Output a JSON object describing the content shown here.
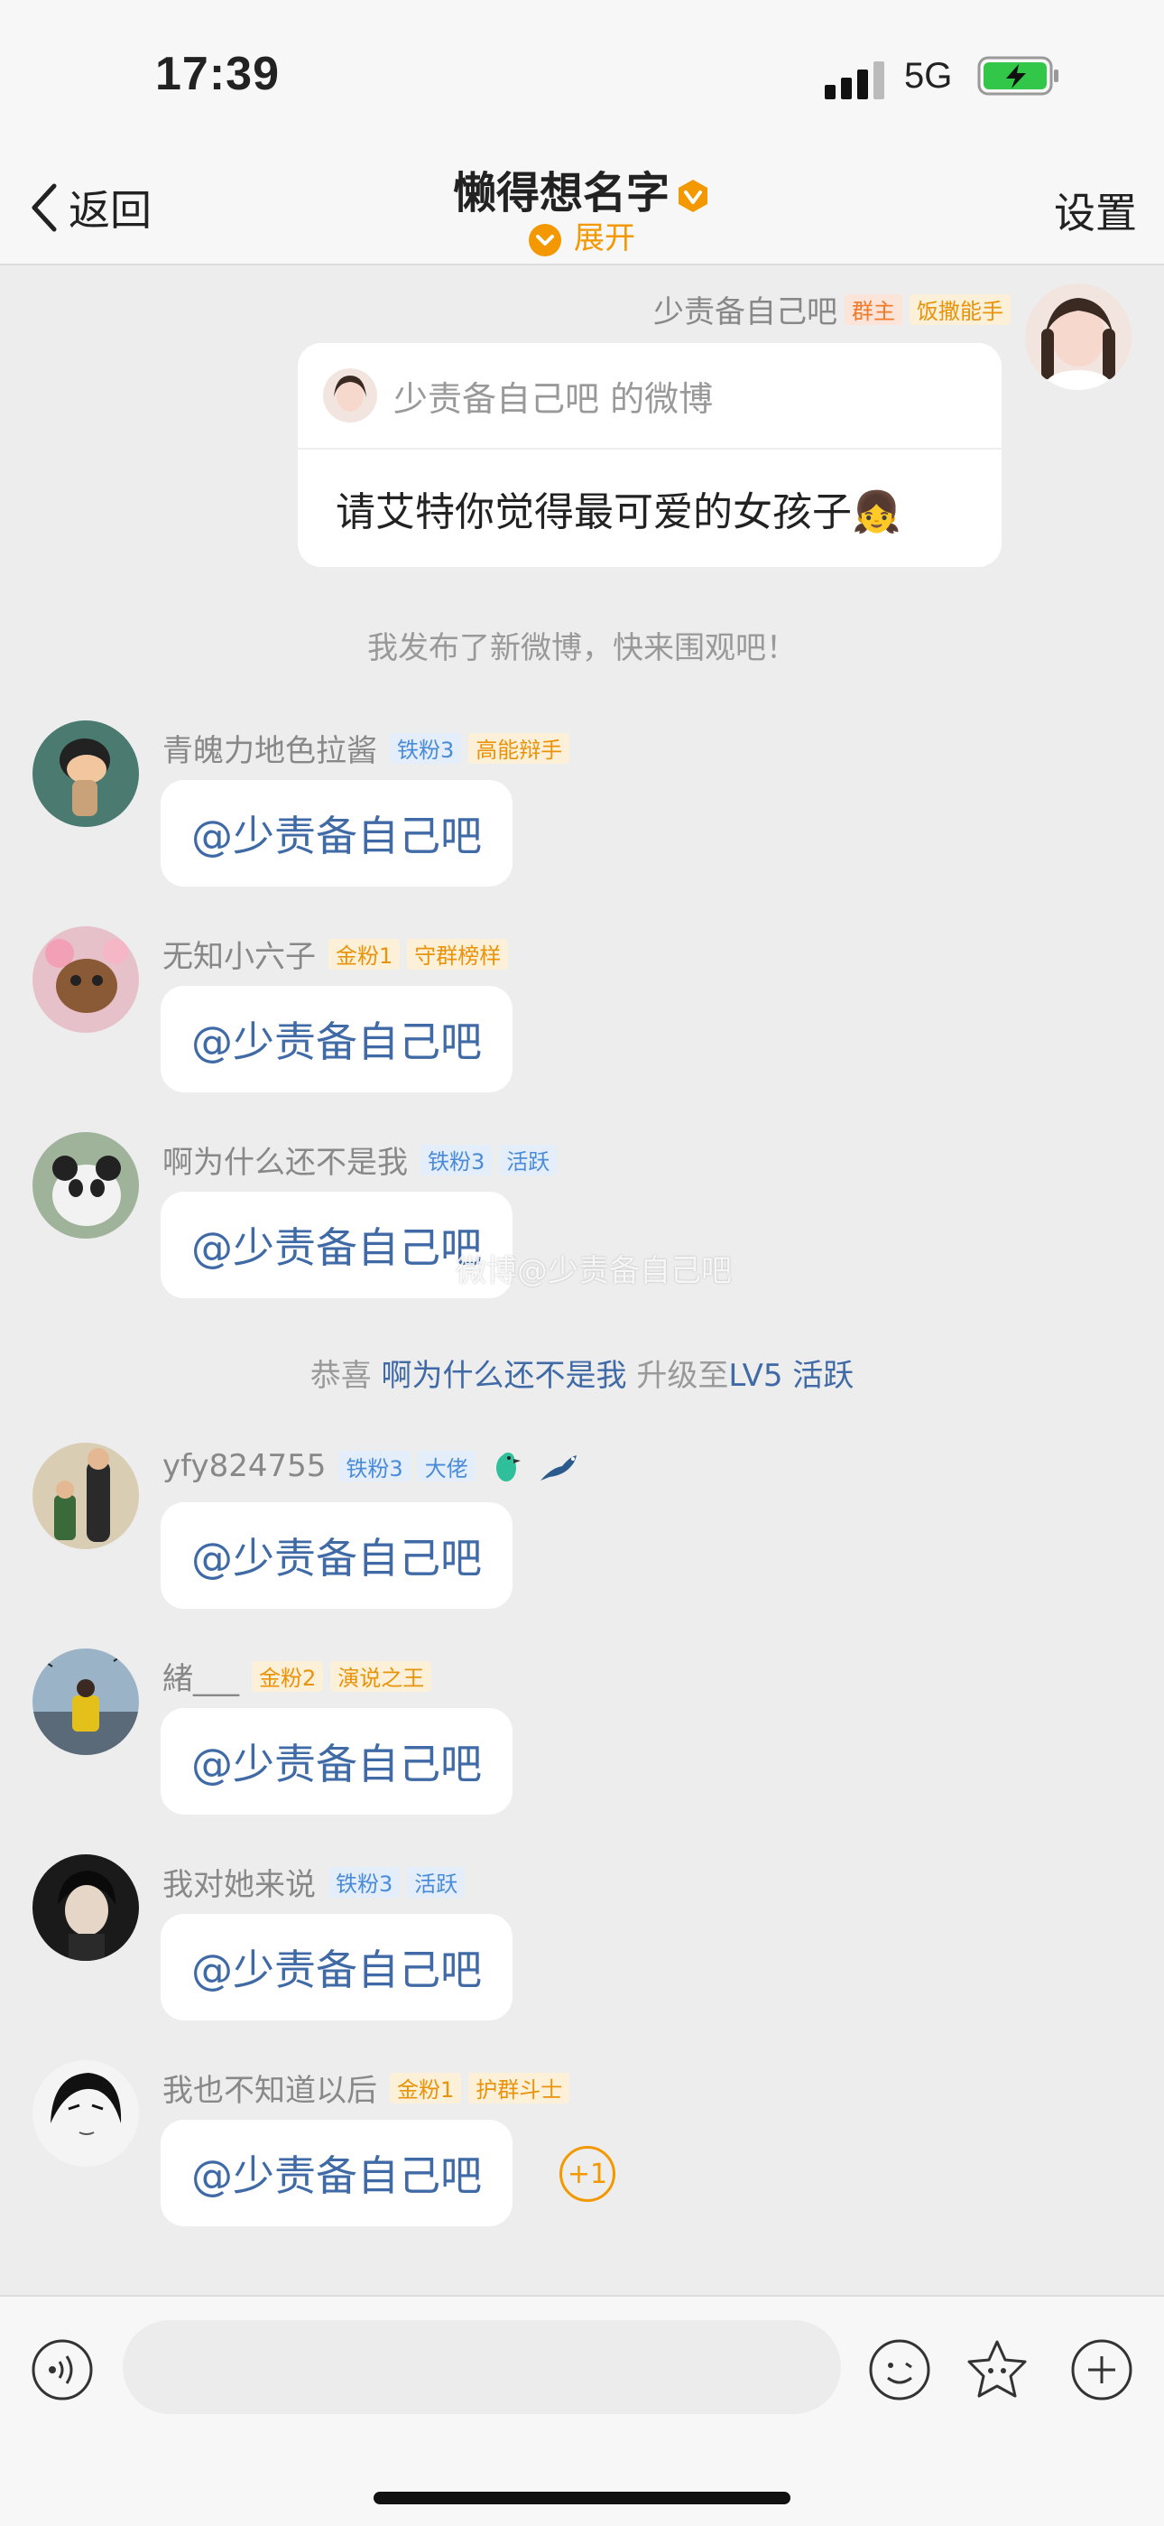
{
  "status": {
    "time": "17:39",
    "network": "5G"
  },
  "nav": {
    "back_label": "返回",
    "title": "懒得想名字",
    "expand_label": "展开",
    "settings_label": "设置"
  },
  "owner": {
    "name": "少责备自己吧",
    "tags": [
      "群主",
      "饭撒能手"
    ],
    "card_header": "少责备自己吧 的微博",
    "card_text": "请艾特你觉得最可爱的女孩子👧"
  },
  "system_messages": [
    "我发布了新微博，快来围观吧！",
    {
      "prefix": "恭喜 ",
      "user": "啊为什么还不是我",
      "middle": " 升级至",
      "level": "LV5 活跃"
    }
  ],
  "watermark": "微博@少责备自己吧",
  "messages": [
    {
      "name": "青魄力地色拉酱",
      "fan": "铁粉3",
      "tag": "高能辩手",
      "text": "@少责备自己吧"
    },
    {
      "name": "无知小六子",
      "fan": "金粉1",
      "tag": "守群榜样",
      "text": "@少责备自己吧"
    },
    {
      "name": "啊为什么还不是我",
      "fan": "铁粉3",
      "tag": "活跃",
      "text": "@少责备自己吧"
    },
    {
      "name": "yfy824755",
      "fan": "铁粉3",
      "tag": "大佬",
      "text": "@少责备自己吧"
    },
    {
      "name": "緒___",
      "fan": "金粉2",
      "tag": "演说之王",
      "text": "@少责备自己吧"
    },
    {
      "name": "我对她来说",
      "fan": "铁粉3",
      "tag": "活跃",
      "text": "@少责备自己吧"
    },
    {
      "name": "我也不知道以后",
      "fan": "金粉1",
      "tag": "护群斗士",
      "text": "@少责备自己吧",
      "reaction": "+1"
    }
  ],
  "colors": {
    "accent": "#f39800",
    "link": "#3f6aa6",
    "background": "#ededed"
  }
}
